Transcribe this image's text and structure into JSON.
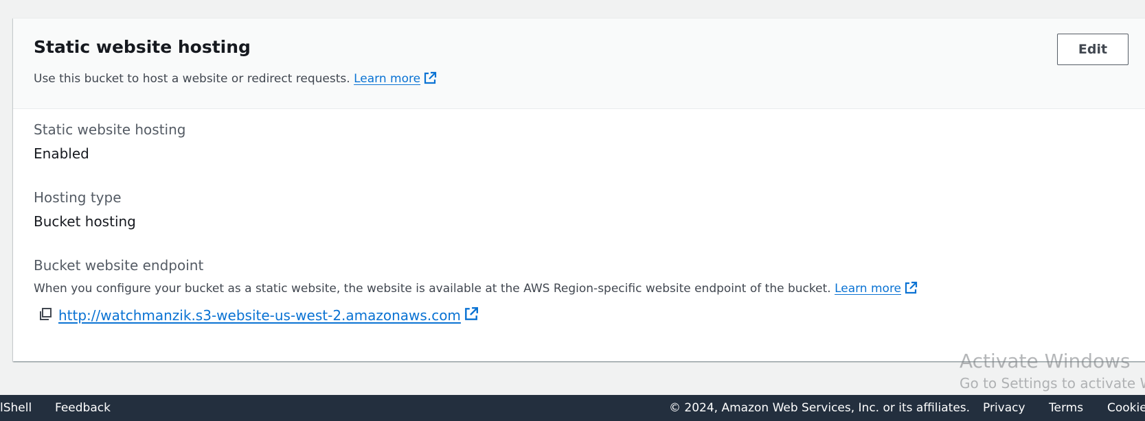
{
  "section": {
    "title": "Static website hosting",
    "description": "Use this bucket to host a website or redirect requests.",
    "learn_more": "Learn more",
    "edit_label": "Edit"
  },
  "fields": {
    "hosting_label": "Static website hosting",
    "hosting_value": "Enabled",
    "type_label": "Hosting type",
    "type_value": "Bucket hosting",
    "endpoint_label": "Bucket website endpoint",
    "endpoint_desc": "When you configure your bucket as a static website, the website is available at the AWS Region-specific website endpoint of the bucket.",
    "endpoint_learn_more": "Learn more",
    "endpoint_url": "http://watchmanzik.s3-website-us-west-2.amazonaws.com"
  },
  "watermark": {
    "line1": "Activate Windows",
    "line2": "Go to Settings to activate W"
  },
  "footer": {
    "cloudshell": "lShell",
    "feedback": "Feedback",
    "copyright": "© 2024, Amazon Web Services, Inc. or its affiliates.",
    "privacy": "Privacy",
    "terms": "Terms",
    "cookie": "Cookie"
  },
  "icons": {
    "external_link": "external-link-icon",
    "copy": "copy-icon"
  },
  "colors": {
    "link": "#0972d3",
    "footer_bg": "#232f3e",
    "header_bg": "#f9fafa"
  }
}
